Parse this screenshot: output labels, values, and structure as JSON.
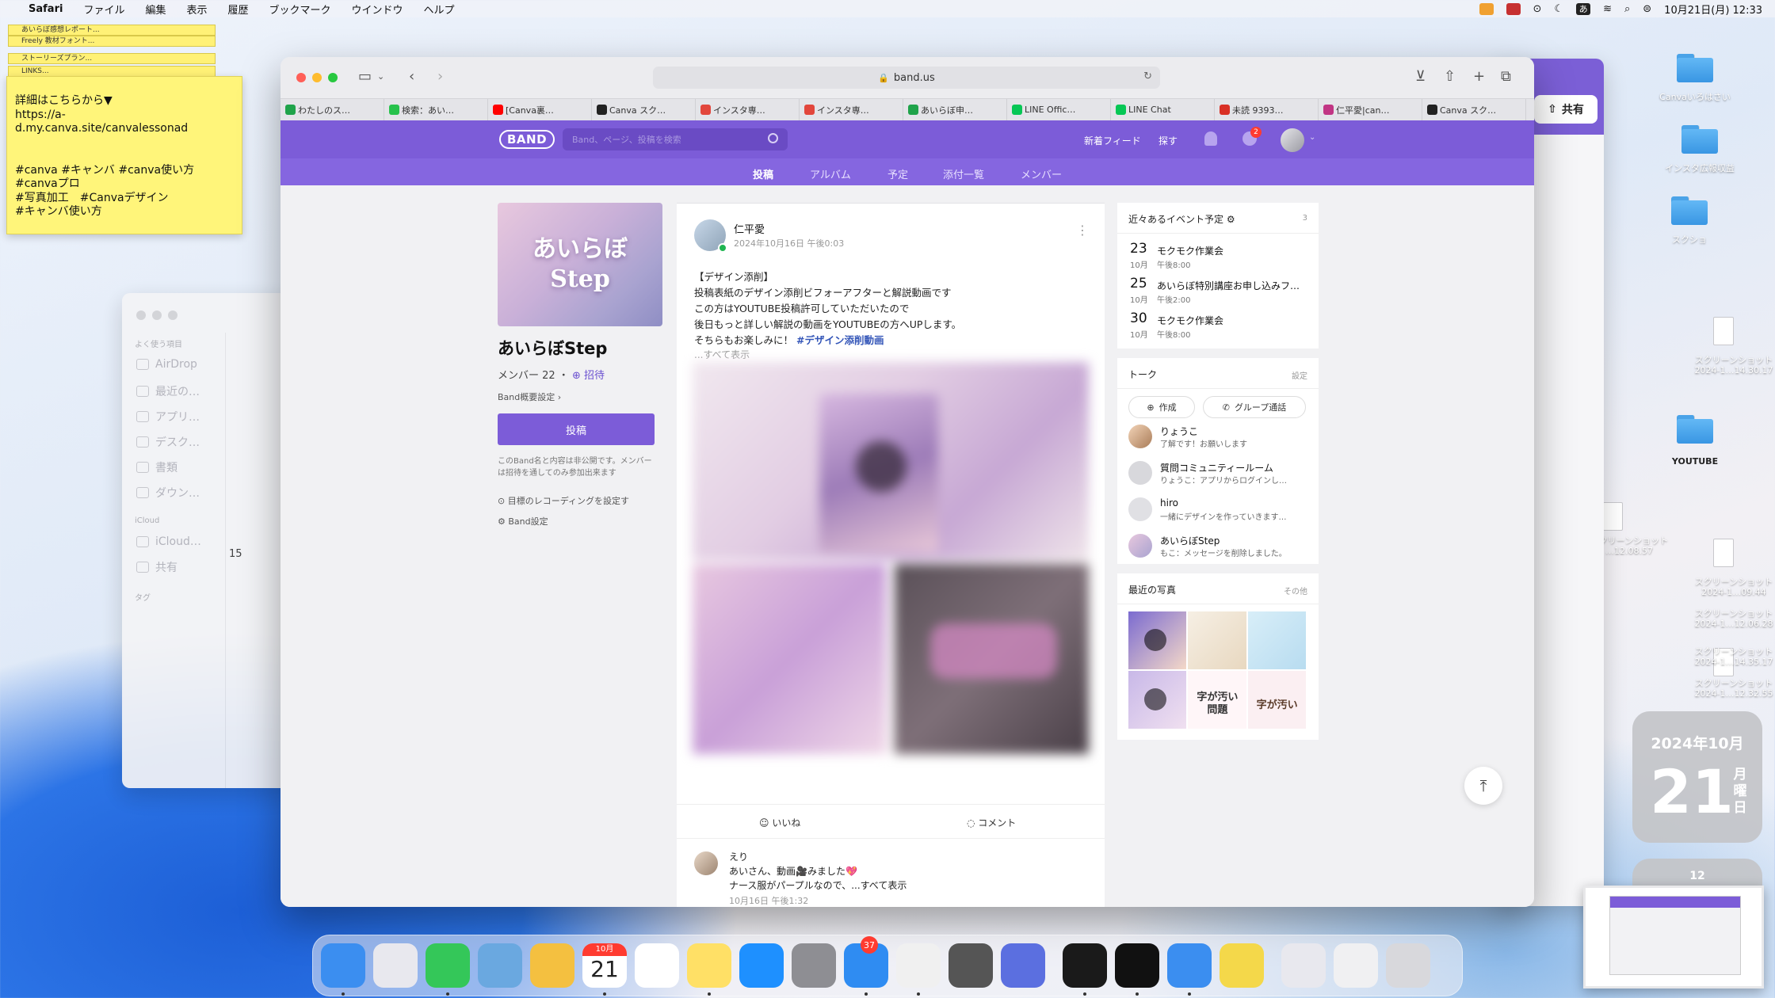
{
  "menubar": {
    "app": "Safari",
    "items": [
      "ファイル",
      "編集",
      "表示",
      "履歴",
      "ブックマーク",
      "ウインドウ",
      "ヘルプ"
    ],
    "clock": "10月21日(月)  12:33",
    "ime": "あ"
  },
  "stickies": {
    "mini": [
      "あいらぼ感想レポート...",
      "Freely 教材フォント...",
      "ストーリーズプラン...",
      "LINKS..."
    ],
    "main_text": "詳細はこちらから▼\nhttps://a-d.my.canva.site/canvalessonad\n\n\n#canva #キャンバ #canva使い方\n#canvaプロ\n#写真加工　#Canvaデザイン\n#キャンバ使い方"
  },
  "finder": {
    "section_favorites": "よく使う項目",
    "favorites": [
      "AirDrop",
      "最近の…",
      "アプリ…",
      "デスク…",
      "書類",
      "ダウン…"
    ],
    "section_icloud": "iCloud",
    "icloud": [
      "iCloud…",
      "共有"
    ],
    "section_tags": "タグ",
    "count": "15"
  },
  "desktop": {
    "folders": [
      "Canvaいろはさい",
      "インスタ広報収益",
      "スクショ",
      "YOUTUBE"
    ],
    "files": [
      "スクリーンショット\n2024-1…14.30.17",
      "スクリーンショット\n…12.08.57",
      "スクリーンショット\n2024-1…09.44",
      "スクリーンショット\n2024-1…12.06.28",
      "スクリーンショット\n2024-1…14.35.17",
      "スクリーンショット\n2024-1…12.32.55"
    ]
  },
  "widgets": {
    "calendar_ym": "2024年10月",
    "calendar_day": "21",
    "calendar_dow": "月曜日",
    "clock_num": "12"
  },
  "back_window": {
    "share_label": "共有"
  },
  "safari": {
    "url": "band.us",
    "tabs": [
      {
        "label": "わたしのス…",
        "color": "#1fa34a"
      },
      {
        "label": "検索：あい…",
        "color": "#27c24c"
      },
      {
        "label": "[Canva裏…",
        "color": "#ff0000"
      },
      {
        "label": "Canva スク…",
        "color": "#222222"
      },
      {
        "label": "インスタ専…",
        "color": "#e2463c"
      },
      {
        "label": "インスタ専…",
        "color": "#e2463c"
      },
      {
        "label": "あいらぼ申…",
        "color": "#1fa34a"
      },
      {
        "label": "LINE Offic…",
        "color": "#06c755"
      },
      {
        "label": "LINE Chat",
        "color": "#06c755"
      },
      {
        "label": "未読 9393…",
        "color": "#d93025"
      },
      {
        "label": "仁平愛|can…",
        "color": "#c13584"
      },
      {
        "label": "Canva スク…",
        "color": "#222222"
      }
    ]
  },
  "band": {
    "logo": "BAND",
    "search_placeholder": "Band、ページ、投稿を検索",
    "header_links": [
      "新着フィード",
      "探す"
    ],
    "notif_badge": "2",
    "nav": [
      "投稿",
      "アルバム",
      "予定",
      "添付一覧",
      "メンバー"
    ],
    "cover_line1": "あいらぼ",
    "cover_line2": "Step",
    "name": "あいらぼStep",
    "members": "メンバー 22 ・",
    "invite": "⊕ 招待",
    "overview": "Band概要設定 ›",
    "post_button": "投稿",
    "note": "このBand名と内容は非公開です。メンバーは招待を通してのみ参加出来ます",
    "goal": "目標のレコーディングを設定す",
    "settings": "Band設定"
  },
  "post": {
    "author": "仁平愛",
    "time": "2024年10月16日 午後0:03",
    "lines": [
      "【デザイン添削】",
      "投稿表紙のデザイン添削ビフォーアフターと解説動画です",
      "この方はYOUTUBE投稿許可していただいたので",
      "後日もっと詳しい解説の動画をYOUTUBEの方へUPします。"
    ],
    "last_line_prefix": "そちらもお楽しみに！ ",
    "hashtag": "#デザイン添削動画",
    "see_all": "...すべて表示",
    "like": "いいね",
    "comment": "コメント",
    "comment_author": "えり",
    "comment_line1": "あいさん、動画🎥みました💖",
    "comment_line2": "ナース服がパープルなので、...すべて表示",
    "comment_time": "10月16日 午後1:32"
  },
  "events": {
    "title": "近々あるイベント予定 ⚙",
    "count": "3",
    "items": [
      {
        "day": "23",
        "mon": "10月",
        "title": "モクモク作業会",
        "time": "午後8:00"
      },
      {
        "day": "25",
        "mon": "10月",
        "title": "あいらぼ特別講座お申し込みフ…",
        "time": "午後2:00"
      },
      {
        "day": "30",
        "mon": "10月",
        "title": "モクモク作業会",
        "time": "午後8:00"
      }
    ]
  },
  "talk": {
    "title": "トーク",
    "settings": "設定",
    "create": "作成",
    "group_call": "グループ通話",
    "items": [
      {
        "name": "りょうこ",
        "msg": "了解です！お願いします"
      },
      {
        "name": "質問コミュニティールーム",
        "msg": "りょうこ：アプリからログインし…"
      },
      {
        "name": "hiro",
        "msg": "一緒にデザインを作っていきます…"
      },
      {
        "name": "あいらぼStep",
        "msg": "もこ：メッセージを削除しました。"
      }
    ]
  },
  "photos": {
    "title": "最近の写真",
    "more": "その他",
    "captions": [
      "",
      "",
      "",
      "",
      "字が汚い問題",
      "字が汚い"
    ]
  },
  "dock": {
    "calendar_month": "10月",
    "calendar_day": "21",
    "mail_badge": "37",
    "apps": [
      "Finder",
      "Launchpad",
      "メッセージ",
      "マップ",
      "写真",
      "カレンダー",
      "リマインダー",
      "メモ",
      "App Store",
      "システム設定",
      "Safari",
      "Chrome",
      "計算機",
      "Canva",
      "アクティビティモニタ",
      "Screen Recorder",
      "メール",
      "スティッキーズ",
      "ヘルプ",
      "プレビュー",
      "ゴミ箱"
    ]
  },
  "colors": {
    "band_purple": "#7c5cd8",
    "band_nav": "#8566e0",
    "hashtag": "#3355b8"
  }
}
